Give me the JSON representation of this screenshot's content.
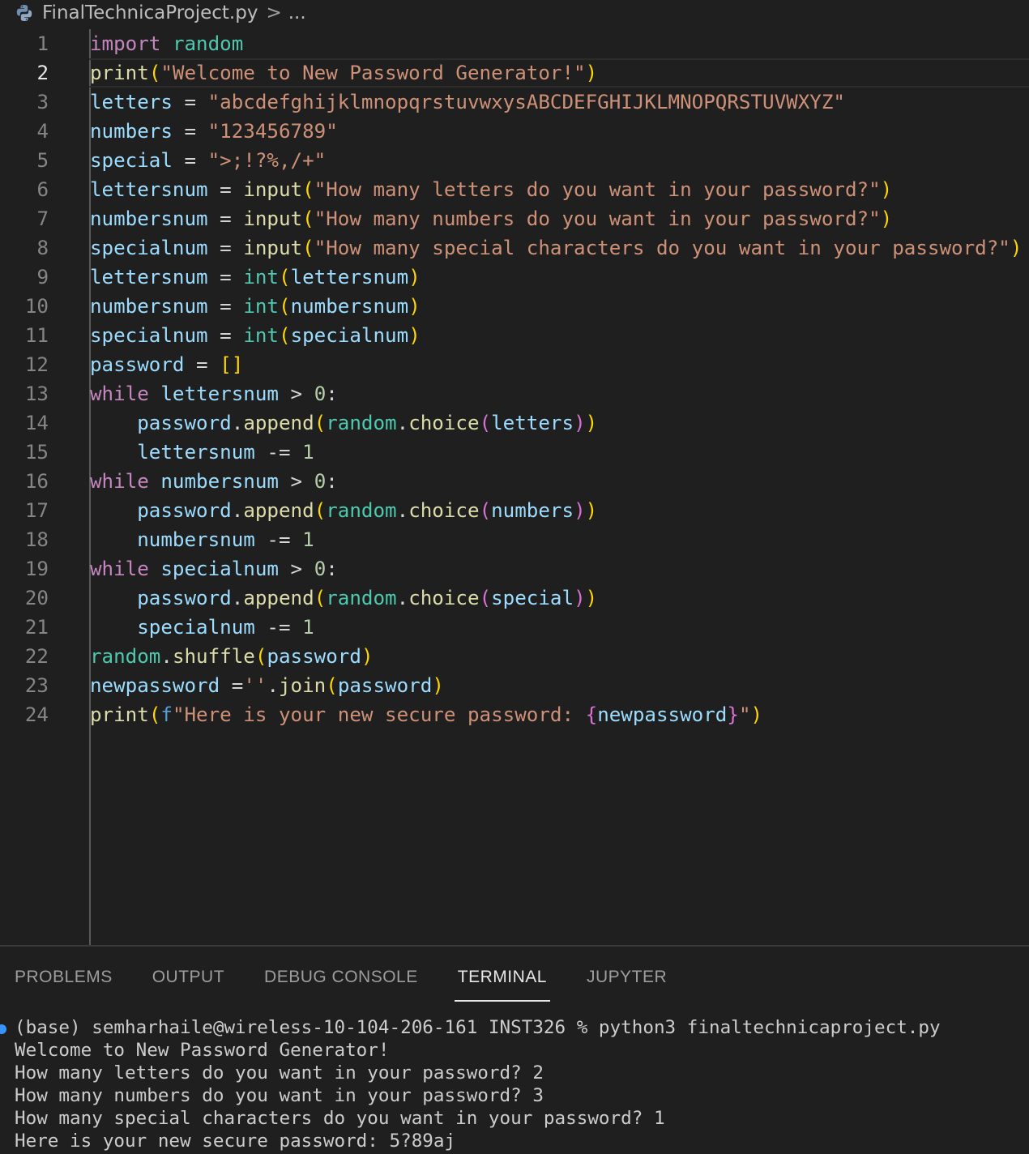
{
  "breadcrumb": {
    "file_name": "FinalTechnicaProject.py",
    "separator": ">",
    "ellipsis": "..."
  },
  "editor": {
    "active_line": 2,
    "lines": [
      {
        "n": "1",
        "tokens": [
          [
            "kw",
            "import"
          ],
          [
            "op",
            " "
          ],
          [
            "mod",
            "random"
          ]
        ]
      },
      {
        "n": "2",
        "tokens": [
          [
            "fn",
            "print"
          ],
          [
            "p1",
            "("
          ],
          [
            "str",
            "\"Welcome to New Password Generator!\""
          ],
          [
            "p1",
            ")"
          ]
        ]
      },
      {
        "n": "3",
        "tokens": [
          [
            "var",
            "letters"
          ],
          [
            "op",
            " = "
          ],
          [
            "str",
            "\"abcdefghijklmnopqrstuvwxysABCDEFGHIJKLMNOPQRSTUVWXYZ\""
          ]
        ]
      },
      {
        "n": "4",
        "tokens": [
          [
            "var",
            "numbers"
          ],
          [
            "op",
            " = "
          ],
          [
            "str",
            "\"123456789\""
          ]
        ]
      },
      {
        "n": "5",
        "tokens": [
          [
            "var",
            "special"
          ],
          [
            "op",
            " = "
          ],
          [
            "str",
            "\">;!?%,/+\""
          ]
        ]
      },
      {
        "n": "6",
        "tokens": [
          [
            "var",
            "lettersnum"
          ],
          [
            "op",
            " = "
          ],
          [
            "fn",
            "input"
          ],
          [
            "p1",
            "("
          ],
          [
            "str",
            "\"How many letters do you want in your password?\""
          ],
          [
            "p1",
            ")"
          ]
        ]
      },
      {
        "n": "7",
        "tokens": [
          [
            "var",
            "numbersnum"
          ],
          [
            "op",
            " = "
          ],
          [
            "fn",
            "input"
          ],
          [
            "p1",
            "("
          ],
          [
            "str",
            "\"How many numbers do you want in your password?\""
          ],
          [
            "p1",
            ")"
          ]
        ]
      },
      {
        "n": "8",
        "tokens": [
          [
            "var",
            "specialnum"
          ],
          [
            "op",
            " = "
          ],
          [
            "fn",
            "input"
          ],
          [
            "p1",
            "("
          ],
          [
            "str",
            "\"How many special characters do you want in your password?\""
          ],
          [
            "p1",
            ")"
          ]
        ]
      },
      {
        "n": "9",
        "tokens": [
          [
            "var",
            "lettersnum"
          ],
          [
            "op",
            " = "
          ],
          [
            "mod",
            "int"
          ],
          [
            "p1",
            "("
          ],
          [
            "var",
            "lettersnum"
          ],
          [
            "p1",
            ")"
          ]
        ]
      },
      {
        "n": "10",
        "tokens": [
          [
            "var",
            "numbersnum"
          ],
          [
            "op",
            " = "
          ],
          [
            "mod",
            "int"
          ],
          [
            "p1",
            "("
          ],
          [
            "var",
            "numbersnum"
          ],
          [
            "p1",
            ")"
          ]
        ]
      },
      {
        "n": "11",
        "tokens": [
          [
            "var",
            "specialnum"
          ],
          [
            "op",
            " = "
          ],
          [
            "mod",
            "int"
          ],
          [
            "p1",
            "("
          ],
          [
            "var",
            "specialnum"
          ],
          [
            "p1",
            ")"
          ]
        ]
      },
      {
        "n": "12",
        "tokens": [
          [
            "var",
            "password"
          ],
          [
            "op",
            " = "
          ],
          [
            "p1",
            "[]"
          ]
        ]
      },
      {
        "n": "13",
        "tokens": [
          [
            "kw",
            "while"
          ],
          [
            "op",
            " "
          ],
          [
            "var",
            "lettersnum"
          ],
          [
            "op",
            " > "
          ],
          [
            "num",
            "0"
          ],
          [
            "op",
            ":"
          ]
        ]
      },
      {
        "n": "14",
        "tokens": [
          [
            "op",
            "    "
          ],
          [
            "var",
            "password"
          ],
          [
            "op",
            "."
          ],
          [
            "fn",
            "append"
          ],
          [
            "p1",
            "("
          ],
          [
            "mod",
            "random"
          ],
          [
            "op",
            "."
          ],
          [
            "fn",
            "choice"
          ],
          [
            "p2",
            "("
          ],
          [
            "var",
            "letters"
          ],
          [
            "p2",
            ")"
          ],
          [
            "p1",
            ")"
          ]
        ]
      },
      {
        "n": "15",
        "tokens": [
          [
            "op",
            "    "
          ],
          [
            "var",
            "lettersnum"
          ],
          [
            "op",
            " -= "
          ],
          [
            "num",
            "1"
          ]
        ]
      },
      {
        "n": "16",
        "tokens": [
          [
            "kw",
            "while"
          ],
          [
            "op",
            " "
          ],
          [
            "var",
            "numbersnum"
          ],
          [
            "op",
            " > "
          ],
          [
            "num",
            "0"
          ],
          [
            "op",
            ":"
          ]
        ]
      },
      {
        "n": "17",
        "tokens": [
          [
            "op",
            "    "
          ],
          [
            "var",
            "password"
          ],
          [
            "op",
            "."
          ],
          [
            "fn",
            "append"
          ],
          [
            "p1",
            "("
          ],
          [
            "mod",
            "random"
          ],
          [
            "op",
            "."
          ],
          [
            "fn",
            "choice"
          ],
          [
            "p2",
            "("
          ],
          [
            "var",
            "numbers"
          ],
          [
            "p2",
            ")"
          ],
          [
            "p1",
            ")"
          ]
        ]
      },
      {
        "n": "18",
        "tokens": [
          [
            "op",
            "    "
          ],
          [
            "var",
            "numbersnum"
          ],
          [
            "op",
            " -= "
          ],
          [
            "num",
            "1"
          ]
        ]
      },
      {
        "n": "19",
        "tokens": [
          [
            "kw",
            "while"
          ],
          [
            "op",
            " "
          ],
          [
            "var",
            "specialnum"
          ],
          [
            "op",
            " > "
          ],
          [
            "num",
            "0"
          ],
          [
            "op",
            ":"
          ]
        ]
      },
      {
        "n": "20",
        "tokens": [
          [
            "op",
            "    "
          ],
          [
            "var",
            "password"
          ],
          [
            "op",
            "."
          ],
          [
            "fn",
            "append"
          ],
          [
            "p1",
            "("
          ],
          [
            "mod",
            "random"
          ],
          [
            "op",
            "."
          ],
          [
            "fn",
            "choice"
          ],
          [
            "p2",
            "("
          ],
          [
            "var",
            "special"
          ],
          [
            "p2",
            ")"
          ],
          [
            "p1",
            ")"
          ]
        ]
      },
      {
        "n": "21",
        "tokens": [
          [
            "op",
            "    "
          ],
          [
            "var",
            "specialnum"
          ],
          [
            "op",
            " -= "
          ],
          [
            "num",
            "1"
          ]
        ]
      },
      {
        "n": "22",
        "tokens": [
          [
            "mod",
            "random"
          ],
          [
            "op",
            "."
          ],
          [
            "fn",
            "shuffle"
          ],
          [
            "p1",
            "("
          ],
          [
            "var",
            "password"
          ],
          [
            "p1",
            ")"
          ]
        ]
      },
      {
        "n": "23",
        "tokens": [
          [
            "var",
            "newpassword"
          ],
          [
            "op",
            " ="
          ],
          [
            "str",
            "''"
          ],
          [
            "op",
            "."
          ],
          [
            "fn",
            "join"
          ],
          [
            "p1",
            "("
          ],
          [
            "var",
            "password"
          ],
          [
            "p1",
            ")"
          ]
        ]
      },
      {
        "n": "24",
        "tokens": [
          [
            "fn",
            "print"
          ],
          [
            "p1",
            "("
          ],
          [
            "ff",
            "f"
          ],
          [
            "str",
            "\"Here is your new secure password: "
          ],
          [
            "p2",
            "{"
          ],
          [
            "var",
            "newpassword"
          ],
          [
            "p2",
            "}"
          ],
          [
            "str",
            "\""
          ],
          [
            "p1",
            ")"
          ]
        ]
      }
    ]
  },
  "panel": {
    "tabs": [
      "PROBLEMS",
      "OUTPUT",
      "DEBUG CONSOLE",
      "TERMINAL",
      "JUPYTER"
    ],
    "active_tab": "TERMINAL",
    "terminal_lines": [
      "(base) semharhaile@wireless-10-104-206-161 INST326 % python3 finaltechnicaproject.py",
      "Welcome to New Password Generator!",
      "How many letters do you want in your password? 2",
      "How many numbers do you want in your password? 3",
      "How many special characters do you want in your password? 1",
      "Here is your new secure password: 5?89aj"
    ]
  },
  "colors": {
    "background": "#1f1f1f",
    "keyword": "#c586c0",
    "module": "#4ec9b0",
    "function": "#dcdcaa",
    "variable": "#9cdcfe",
    "string": "#ce9178",
    "number": "#b5cea8",
    "bracket_level1": "#ffd700",
    "bracket_level2": "#da70d6",
    "terminal_status_dot": "#3794ff"
  },
  "icons": {
    "breadcrumb_file_icon": "python-file-icon",
    "terminal_status": "terminal-success-dot-icon"
  }
}
